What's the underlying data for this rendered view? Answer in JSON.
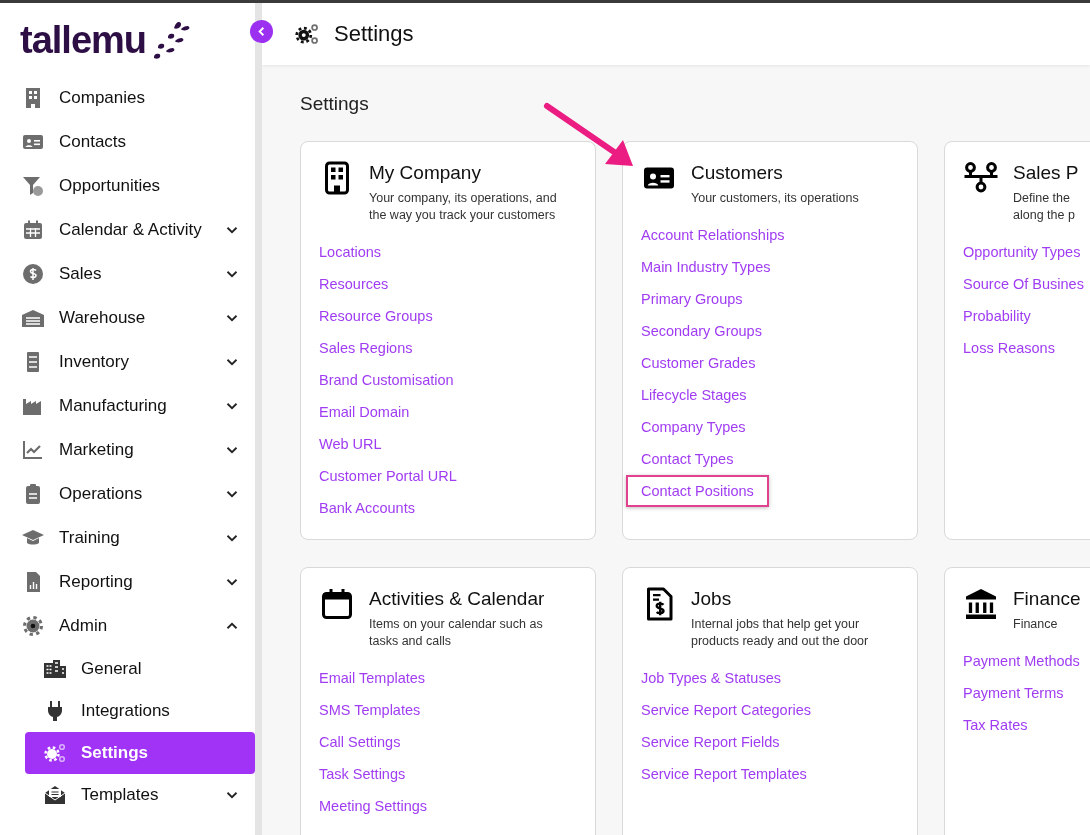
{
  "logo": {
    "text": "tallemu"
  },
  "sidebar": {
    "items": [
      {
        "label": "Companies",
        "selected": false
      },
      {
        "label": "Contacts",
        "selected": false
      },
      {
        "label": "Opportunities",
        "selected": false
      },
      {
        "label": "Calendar & Activity",
        "selected": false,
        "expanded": false
      },
      {
        "label": "Sales",
        "selected": false,
        "expanded": false
      },
      {
        "label": "Warehouse",
        "selected": false,
        "expanded": false
      },
      {
        "label": "Inventory",
        "selected": false,
        "expanded": false
      },
      {
        "label": "Manufacturing",
        "selected": false,
        "expanded": false
      },
      {
        "label": "Marketing",
        "selected": false,
        "expanded": false
      },
      {
        "label": "Operations",
        "selected": false,
        "expanded": false
      },
      {
        "label": "Training",
        "selected": false,
        "expanded": false
      },
      {
        "label": "Reporting",
        "selected": false,
        "expanded": false
      },
      {
        "label": "Admin",
        "selected": false,
        "expanded": true,
        "children": [
          {
            "label": "General",
            "selected": false
          },
          {
            "label": "Integrations",
            "selected": false
          },
          {
            "label": "Settings",
            "selected": true
          },
          {
            "label": "Templates",
            "selected": false,
            "expanded": false
          }
        ]
      }
    ]
  },
  "header": {
    "title": "Settings"
  },
  "page_title": "Settings",
  "cards": [
    {
      "title": "My Company",
      "description": "Your company, its operations, and\nthe way you track your customers",
      "arrow": false,
      "links": [
        {
          "label": "Locations",
          "highlighted": false
        },
        {
          "label": "Resources",
          "highlighted": false
        },
        {
          "label": "Resource Groups",
          "highlighted": false
        },
        {
          "label": "Sales Regions",
          "highlighted": false
        },
        {
          "label": "Brand Customisation",
          "highlighted": false
        },
        {
          "label": "Email Domain",
          "highlighted": false
        },
        {
          "label": "Web URL",
          "highlighted": false
        },
        {
          "label": "Customer Portal URL",
          "highlighted": false
        },
        {
          "label": "Bank Accounts",
          "highlighted": false
        }
      ]
    },
    {
      "title": "Customers",
      "description": "Your customers, its operations",
      "arrow": true,
      "links": [
        {
          "label": "Account Relationships",
          "highlighted": false
        },
        {
          "label": "Main Industry Types",
          "highlighted": false
        },
        {
          "label": "Primary Groups",
          "highlighted": false
        },
        {
          "label": "Secondary Groups",
          "highlighted": false
        },
        {
          "label": "Customer Grades",
          "highlighted": false
        },
        {
          "label": "Lifecycle Stages",
          "highlighted": false
        },
        {
          "label": "Company Types",
          "highlighted": false
        },
        {
          "label": "Contact Types",
          "highlighted": false
        },
        {
          "label": "Contact Positions",
          "highlighted": true
        }
      ]
    },
    {
      "title": "Sales P",
      "description": "Define the\nalong the p",
      "arrow": false,
      "links": [
        {
          "label": "Opportunity Types",
          "highlighted": false
        },
        {
          "label": "Source Of Busines",
          "highlighted": false
        },
        {
          "label": "Probability",
          "highlighted": false
        },
        {
          "label": "Loss Reasons",
          "highlighted": false
        }
      ]
    },
    {
      "title": "Activities & Calendar",
      "description": "Items on your calendar such as\ntasks and calls",
      "arrow": false,
      "links": [
        {
          "label": "Email Templates",
          "highlighted": false
        },
        {
          "label": "SMS Templates",
          "highlighted": false
        },
        {
          "label": "Call Settings",
          "highlighted": false
        },
        {
          "label": "Task Settings",
          "highlighted": false
        },
        {
          "label": "Meeting Settings",
          "highlighted": false
        }
      ]
    },
    {
      "title": "Jobs",
      "description": "Internal jobs that help get your\nproducts ready and out the door",
      "arrow": false,
      "links": [
        {
          "label": "Job Types & Statuses",
          "highlighted": false
        },
        {
          "label": "Service Report Categories",
          "highlighted": false
        },
        {
          "label": "Service Report Fields",
          "highlighted": false
        },
        {
          "label": "Service Report Templates",
          "highlighted": false
        }
      ]
    },
    {
      "title": "Finance",
      "description": "Finance",
      "arrow": false,
      "links": [
        {
          "label": "Payment Methods",
          "highlighted": false
        },
        {
          "label": "Payment Terms",
          "highlighted": false
        },
        {
          "label": "Tax Rates",
          "highlighted": false
        }
      ]
    }
  ]
}
